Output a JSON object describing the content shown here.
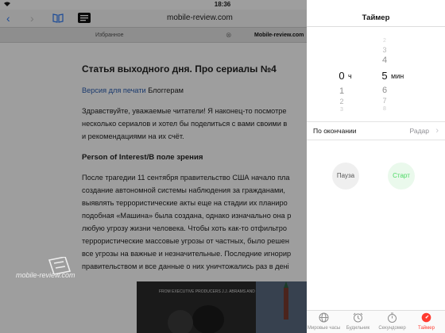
{
  "status": {
    "time": "18:36"
  },
  "browser": {
    "url": "mobile-review.com",
    "tabs": [
      "Избранное",
      "Mobile-review.com"
    ],
    "back_icon": "chevron-left",
    "forward_icon": "chevron-right",
    "bookmarks_icon": "book",
    "reader_icon": "reader"
  },
  "article": {
    "title": "Статья выходного дня. Про сериалы №4",
    "print_link": "Версия для печати",
    "blog_link": "Блоггерам",
    "para1": [
      "Здравствуйте, уважаемые читатели! Я наконец-то посмотре",
      "несколько сериалов и хотел бы поделиться с вами своими в",
      "и рекомендациями на их счёт."
    ],
    "heading": "Person of Interest/В поле зрения",
    "para2": [
      "После трагедии 11 сентября правительство США начало пла",
      "создание автономной системы наблюдения за гражданами,",
      "выявлять террористические акты еще на стадии их планиро",
      "подобная «Машина» была создана, однако изначально она р",
      "любую угрозу жизни человека. Чтобы хоть как-то отфильтро",
      "террористические массовые угрозы от частных, было решен",
      "все угрозы на важные и незначительные. Последние игнорир",
      "правительством и все данные о них уничтожались раз в дені"
    ],
    "poster_text": "FROM EXECUTIVE PRODUCERS J.J. ABRAMS AND JONATHAN NOLAN"
  },
  "watermark": "mobile-review.com",
  "timer": {
    "title": "Таймер",
    "hours_above": [
      "",
      "",
      ""
    ],
    "hours_selected": "0",
    "hours_unit": "ч",
    "hours_below": [
      "1",
      "2",
      "3"
    ],
    "minutes_above": [
      "2",
      "3",
      "4"
    ],
    "minutes_selected": "5",
    "minutes_unit": "мин",
    "minutes_below": [
      "6",
      "7",
      "8"
    ],
    "on_end_label": "По окончании",
    "on_end_value": "Радар",
    "pause_label": "Пауза",
    "start_label": "Старт",
    "start_color": "#4cd964",
    "accent": "#ff3b30"
  },
  "tabbar": [
    {
      "label": "Мировые часы",
      "icon": "globe-icon"
    },
    {
      "label": "Будильник",
      "icon": "alarm-icon"
    },
    {
      "label": "Секундомер",
      "icon": "stopwatch-icon"
    },
    {
      "label": "Таймер",
      "icon": "timer-icon"
    }
  ]
}
